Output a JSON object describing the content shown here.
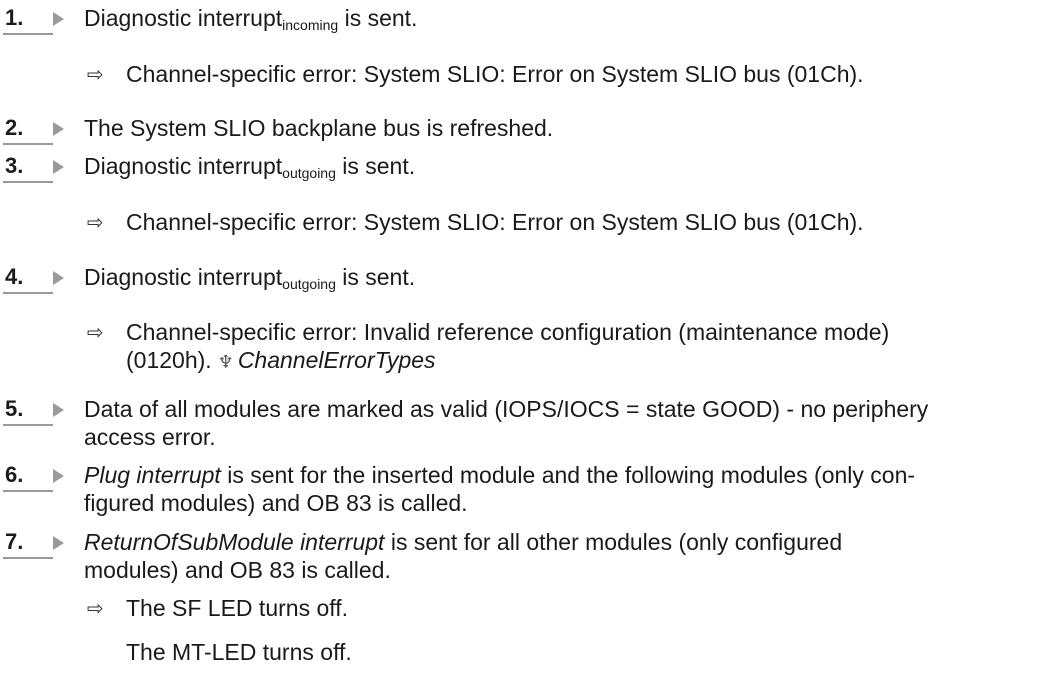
{
  "steps": [
    {
      "num": "1.",
      "pre": "Diagnostic interrupt",
      "sub": "incoming",
      "post": " is sent."
    },
    {
      "num": "2.",
      "text": "The System SLIO backplane bus is refreshed."
    },
    {
      "num": "3.",
      "pre": "Diagnostic interrupt",
      "sub": "outgoing",
      "post": " is sent."
    },
    {
      "num": "4.",
      "pre": "Diagnostic interrupt",
      "sub": "outgoing",
      "post": " is sent."
    },
    {
      "num": "5.",
      "line1": "Data of all modules are marked as valid (IOPS/IOCS = state GOOD) - no periphery",
      "line2": "access error."
    },
    {
      "num": "6.",
      "italic": "Plug interrupt",
      "line1_rest": " is sent for the inserted module and the following modules (only con-",
      "line2": "figured modules) and OB 83 is called."
    },
    {
      "num": "7.",
      "italic": "ReturnOfSubModule interrupt",
      "line1_rest": " is sent for all other modules (only configured",
      "line2": "modules) and OB 83 is called."
    }
  ],
  "results": {
    "r1": "Channel-specific error: System SLIO: Error on System SLIO bus (01Ch).",
    "r3": "Channel-specific error: System SLIO: Error on System SLIO bus (01Ch).",
    "r4_line1": "Channel-specific error: Invalid reference configuration (maintenance mode)",
    "r4_line2": "(0120h).",
    "r4_link": "ChannelErrorTypes",
    "r7_line1": "The SF LED turns off.",
    "r7_line2": "The MT-LED turns off."
  },
  "symbols": {
    "result_arrow": "⇨",
    "link_symbol": "♆"
  },
  "colors": {
    "text": "#1a1a1a",
    "step_marker": "#9a9a9a"
  }
}
